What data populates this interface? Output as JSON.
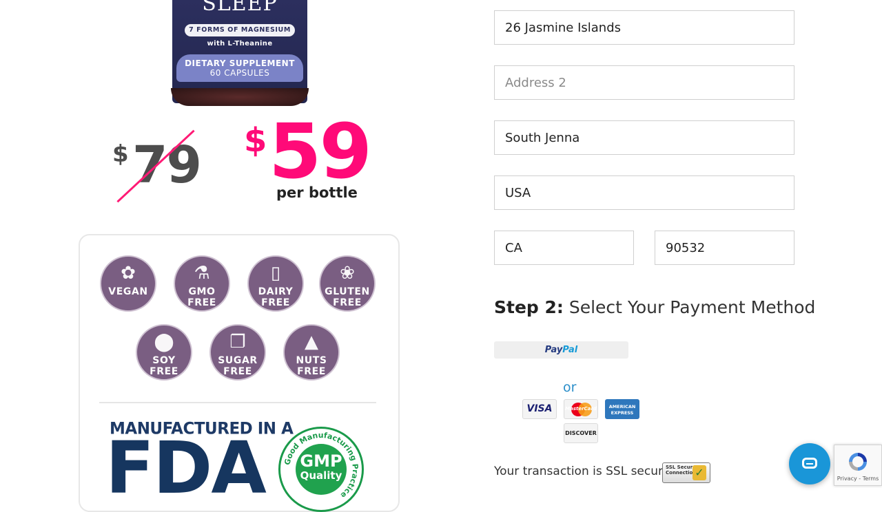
{
  "product": {
    "name": "SLEEP",
    "forms": "7 FORMS OF MAGNESIUM",
    "with": "with L-Theanine",
    "supplement": "DIETARY SUPPLEMENT",
    "capsules": "60 CAPSULES"
  },
  "pricing": {
    "old_currency": "$",
    "old_price": "79",
    "new_currency": "$",
    "new_price": "59",
    "per_unit": "per bottle"
  },
  "badges": [
    {
      "icon": "leaf-icon",
      "label1": "VEGAN",
      "label2": ""
    },
    {
      "icon": "flask-icon",
      "label1": "GMO",
      "label2": "FREE"
    },
    {
      "icon": "milk-icon",
      "label1": "DAIRY",
      "label2": "FREE"
    },
    {
      "icon": "wheat-icon",
      "label1": "GLUTEN",
      "label2": "FREE"
    },
    {
      "icon": "bean-icon",
      "label1": "SOY",
      "label2": "FREE"
    },
    {
      "icon": "sugar-cube-icon",
      "label1": "SUGAR",
      "label2": "FREE"
    },
    {
      "icon": "acorn-icon",
      "label1": "NUTS",
      "label2": "FREE"
    }
  ],
  "manufactured": {
    "line1": "MANUFACTURED IN A",
    "line2": "FDA"
  },
  "gmp": {
    "ring_text": "Good Manufacturing Practice",
    "title": "GMP",
    "subtitle": "Quality"
  },
  "form": {
    "address1_value": "26 Jasmine Islands",
    "address2_placeholder": "Address 2",
    "city_value": "South Jenna",
    "country_value": "USA",
    "state_value": "CA",
    "zip_value": "90532"
  },
  "payment": {
    "step_label": "Step 2:",
    "step_text": "Select Your Payment Method",
    "paypal_pay": "Pay",
    "paypal_pal": "Pal",
    "or": "or",
    "visa": "VISA",
    "mastercard": "MasterCard",
    "amex": "AMERICAN EXPRESS",
    "discover": "DISCOVER",
    "secured_text": "Your transaction is SSL secured",
    "ssl_badge": "SSL Secure Connection"
  },
  "recaptcha": {
    "terms": "Privacy - Terms"
  },
  "colors": {
    "accent_pink": "#ff0a78",
    "badge_purple": "#7a5e82",
    "fda_navy": "#16365f",
    "gmp_green": "#20a24e",
    "or_blue": "#2a8ec9",
    "chat_blue": "#1a96d8"
  }
}
